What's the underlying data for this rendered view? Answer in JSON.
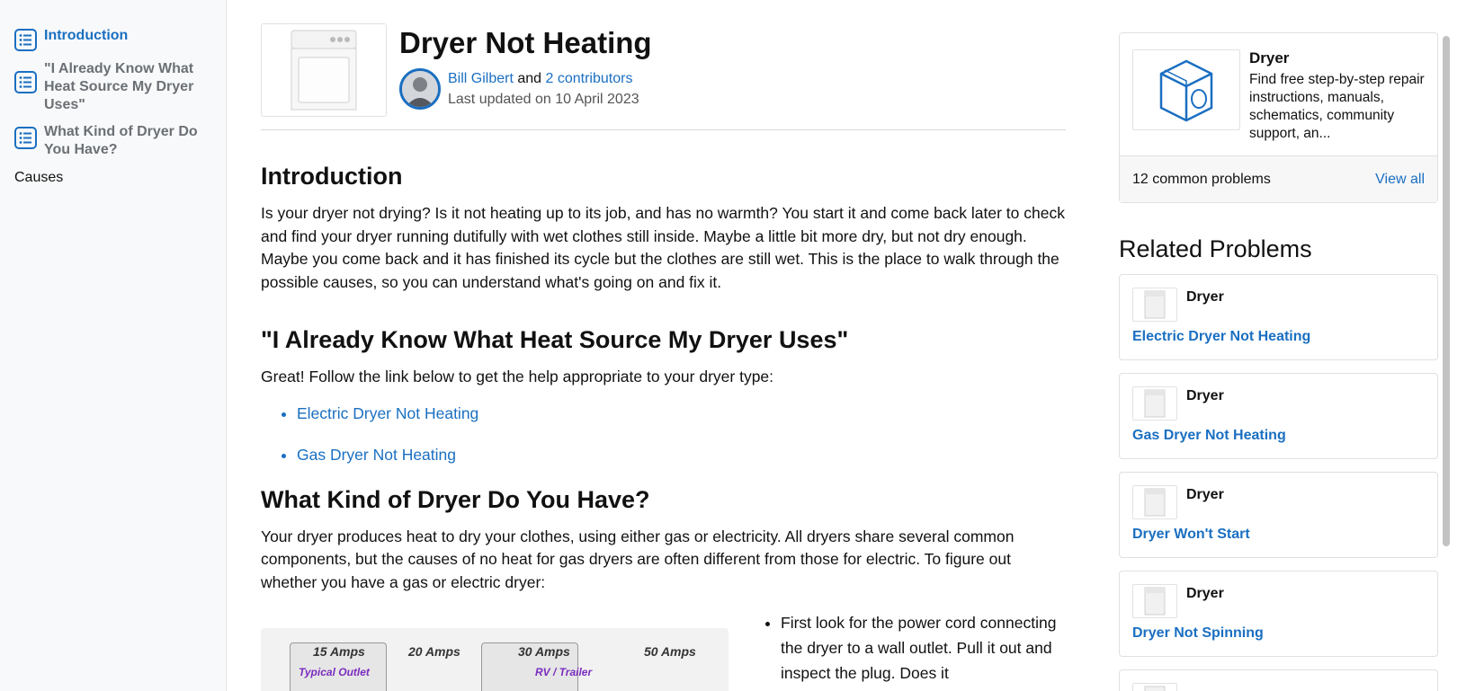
{
  "toc": {
    "items": [
      {
        "label": "Introduction",
        "active": true
      },
      {
        "label": "\"I Already Know What Heat Source My Dryer Uses\"",
        "active": false
      },
      {
        "label": "What Kind of Dryer Do You Have?",
        "active": false
      }
    ],
    "plain": "Causes"
  },
  "header": {
    "title": "Dryer Not Heating",
    "author": "Bill Gilbert",
    "and_text": "and",
    "contributors": "2 contributors",
    "updated": "Last updated on 10 April 2023"
  },
  "sections": {
    "intro": {
      "heading": "Introduction",
      "text": "Is your dryer not drying? Is it not heating up to its job, and has no warmth? You start it and come back later to check and find your dryer running dutifully with wet clothes still inside. Maybe a little bit more dry, but not dry enough. Maybe you come back and it has finished its cycle but the clothes are still wet. This is the place to walk through the possible causes, so you can understand what's going on and fix it."
    },
    "heat_source": {
      "heading": "\"I Already Know What Heat Source My Dryer Uses\"",
      "text": "Great! Follow the link below to get the help appropriate to your dryer type:",
      "links": [
        "Electric Dryer Not Heating",
        "Gas Dryer Not Heating"
      ]
    },
    "kind": {
      "heading": "What Kind of Dryer Do You Have?",
      "text": "Your dryer produces heat to dry your clothes, using either gas or electricity. All dryers share several common components, but the causes of no heat for gas dryers are often different from those for electric. To figure out whether you have a gas or electric dryer:",
      "bullet": "First look for the power cord connecting the dryer to a wall outlet. Pull it out and inspect the plug. Does it"
    }
  },
  "amps_figure": {
    "labels": [
      "15 Amps",
      "20 Amps",
      "30 Amps",
      "50 Amps"
    ],
    "sub1": "Typical Outlet",
    "sub2": "RV / Trailer"
  },
  "device": {
    "name": "Dryer",
    "desc": "Find free step-by-step repair instructions, manuals, schematics, community support, an...",
    "count": "12 common problems",
    "view_all": "View all"
  },
  "related": {
    "heading": "Related Problems",
    "items": [
      {
        "category": "Dryer",
        "title": "Electric Dryer Not Heating"
      },
      {
        "category": "Dryer",
        "title": "Gas Dryer Not Heating"
      },
      {
        "category": "Dryer",
        "title": "Dryer Won't Start"
      },
      {
        "category": "Dryer",
        "title": "Dryer Not Spinning"
      }
    ]
  },
  "colors": {
    "link": "#1a6fc1",
    "text": "#111111",
    "toc_bg": "#f8f9fa"
  }
}
